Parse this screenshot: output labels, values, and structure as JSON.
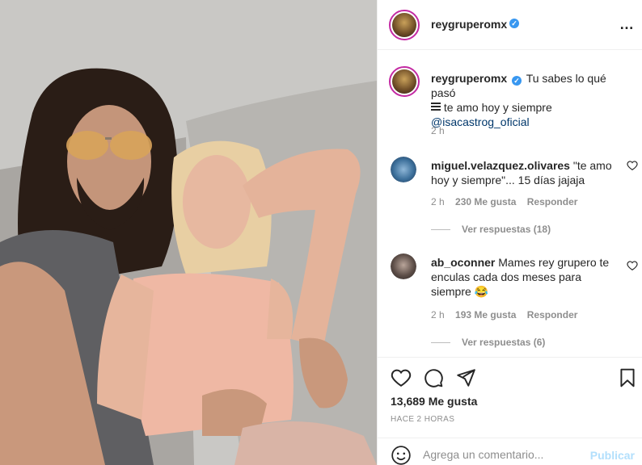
{
  "post": {
    "username": "reygruperomx",
    "more_icon": "…"
  },
  "caption": {
    "username": "reygruperomx",
    "text_part1": "Tu sabes lo qué pasó",
    "text_part2": "te amo hoy y siempre",
    "mention": "@isacastrog_oficial",
    "time": "2 h"
  },
  "comments": [
    {
      "username": "miguel.velazquez.olivares",
      "text_line1": "\"te amo",
      "text_line2": "hoy y siempre\"... 15 días jajaja",
      "time": "2 h",
      "likes": "230 Me gusta",
      "reply": "Responder",
      "view_replies": "Ver respuestas (18)"
    },
    {
      "username": "ab_oconner",
      "text_line1": "Mames rey grupero te",
      "text_line2": "enculas cada dos meses para",
      "text_line3": "siempre 😂",
      "time": "2 h",
      "likes": "193 Me gusta",
      "reply": "Responder",
      "view_replies": "Ver respuestas (6)"
    }
  ],
  "actions": {
    "likes_count": "13,689 Me gusta",
    "time_ago": "HACE 2 HORAS"
  },
  "comment_box": {
    "placeholder": "Agrega un comentario...",
    "publish": "Publicar"
  },
  "colors": {
    "verified": "#3897f0",
    "story_ring": "#c32aa3",
    "mention": "#00376b",
    "publish_disabled": "#b2dffc"
  },
  "icons": [
    "verified-icon",
    "more-icon",
    "heart-icon",
    "comment-icon",
    "share-icon",
    "bookmark-icon",
    "emoji-icon"
  ]
}
